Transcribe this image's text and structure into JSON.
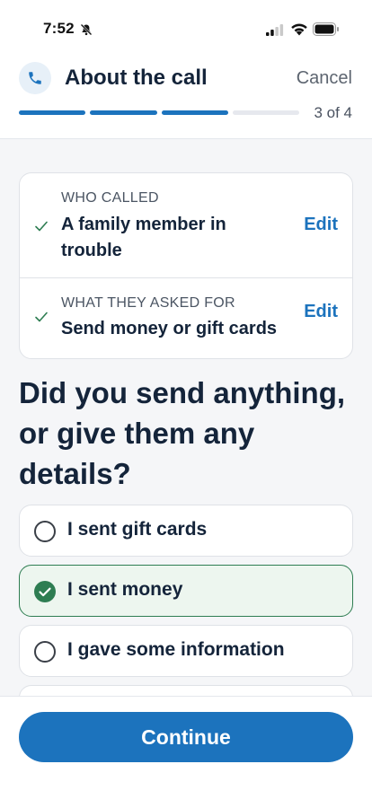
{
  "status_bar": {
    "time": "7:52"
  },
  "header": {
    "title": "About the call",
    "cancel_label": "Cancel",
    "step_text": "3 of 4",
    "progress": {
      "completed_steps": 3,
      "total_steps": 4
    },
    "icon": "phone-icon"
  },
  "summary": {
    "items": [
      {
        "label": "WHO CALLED",
        "value": "A family member in trouble",
        "edit_label": "Edit"
      },
      {
        "label": "WHAT THEY ASKED FOR",
        "value": "Send money or gift cards",
        "edit_label": "Edit"
      }
    ]
  },
  "question": "Did you send anything, or give them any details?",
  "options": [
    {
      "label": "I sent gift cards",
      "selected": false
    },
    {
      "label": "I sent money",
      "selected": true
    },
    {
      "label": "I gave some information",
      "selected": false
    }
  ],
  "footer": {
    "continue_label": "Continue"
  },
  "colors": {
    "accent": "#1c73bd",
    "selected_border": "#2e7d52",
    "selected_bg": "#edf6ef",
    "check": "#2e7d52"
  }
}
